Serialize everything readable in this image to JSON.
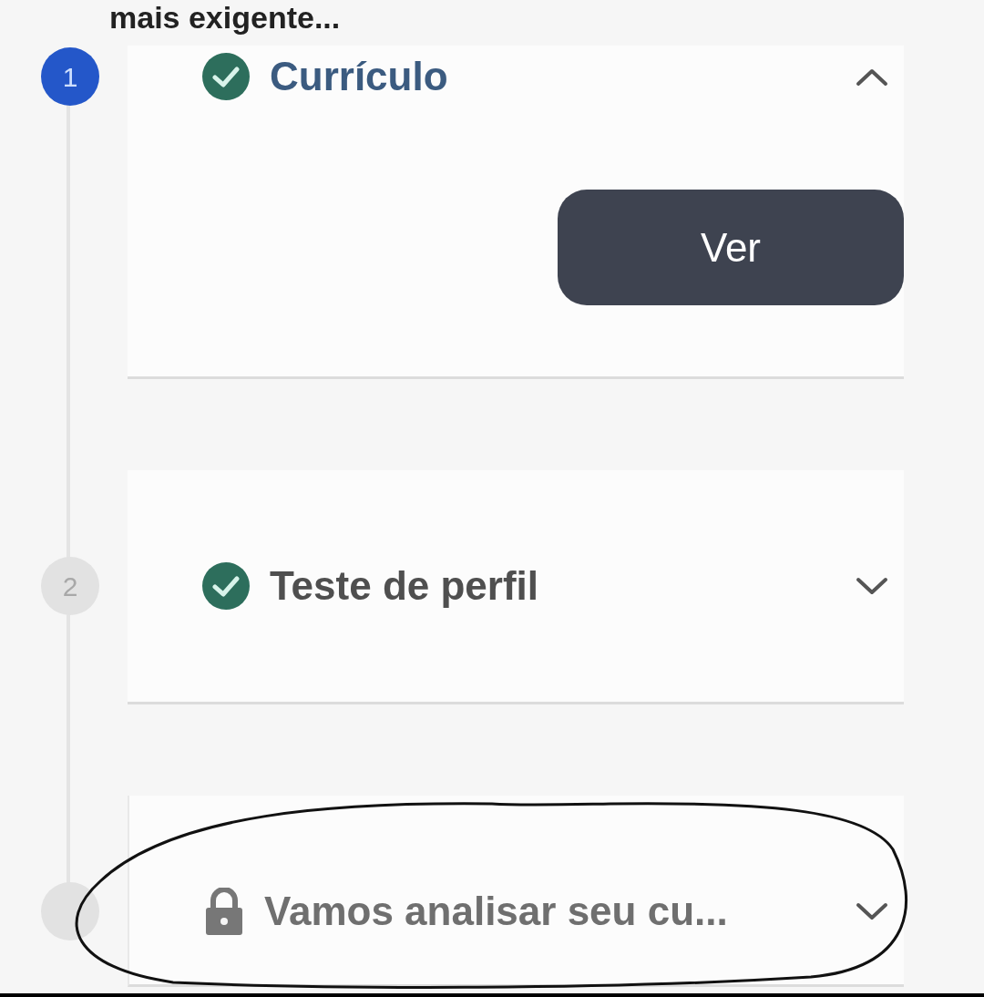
{
  "heading": "mais exigente...",
  "steps": [
    {
      "number": "1",
      "active": true,
      "title": "Currículo",
      "kind": "done",
      "expanded": true,
      "button": "Ver"
    },
    {
      "number": "2",
      "active": false,
      "title": "Teste de perfil",
      "kind": "done",
      "expanded": false
    },
    {
      "active": false,
      "title": "Vamos analisar seu cu...",
      "kind": "locked",
      "expanded": false
    }
  ],
  "annotation": {
    "kind": "ellipse"
  }
}
